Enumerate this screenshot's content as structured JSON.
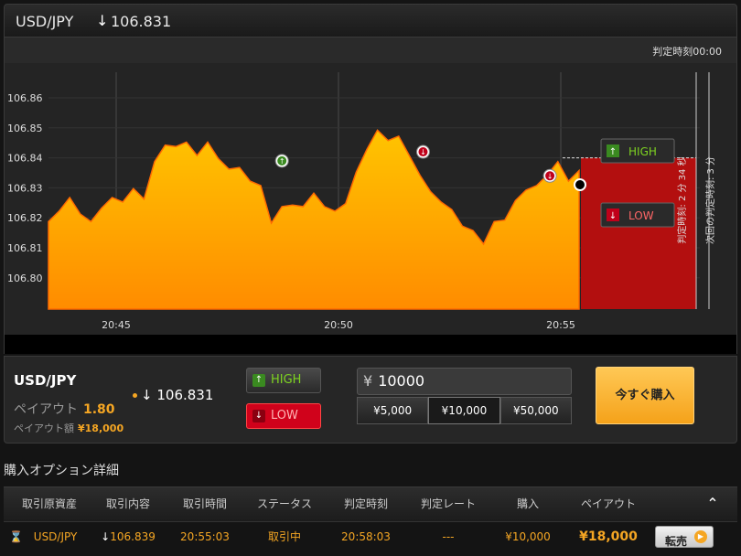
{
  "header": {
    "pair": "USD/JPY",
    "direction_icon": "arrow-down-icon",
    "direction_glyph": "↓",
    "rate": "106.831"
  },
  "subbar": {
    "judge_time": "判定時刻00:00"
  },
  "chart": {
    "yticks": [
      "106.86",
      "106.85",
      "106.84",
      "106.83",
      "106.82",
      "106.81",
      "106.80"
    ],
    "xticks": [
      "20:45",
      "20:50",
      "20:55"
    ],
    "high_label": "HIGH",
    "low_label": "LOW",
    "judge_remaining": "判定時刻: 2 分 34 秒",
    "next_round": "次回の判定時刻: 3 分"
  },
  "chart_data": {
    "type": "area",
    "y_range": [
      106.795,
      106.87
    ],
    "x_ticks": [
      "20:45",
      "20:50",
      "20:55"
    ],
    "series": [
      {
        "values": [
          106.818,
          106.823,
          106.826,
          106.822,
          106.818,
          106.824,
          106.826,
          106.826,
          106.829,
          106.827,
          106.838,
          106.845,
          106.843,
          106.846,
          106.84,
          106.846,
          106.839,
          106.837,
          106.836,
          106.833,
          106.83,
          106.819,
          106.823,
          106.825,
          106.823,
          106.829,
          106.823,
          106.823,
          106.824,
          106.836,
          106.842,
          106.85,
          106.845,
          106.848,
          106.84,
          106.835,
          106.828,
          106.826,
          106.822,
          106.818,
          106.815,
          106.812,
          106.818,
          106.82,
          106.825,
          106.83,
          106.83,
          106.835,
          106.838,
          106.833,
          106.835
        ]
      }
    ],
    "markers": [
      {
        "kind": "high-entry",
        "x": 0.44,
        "y": 106.839
      },
      {
        "kind": "low-entry",
        "x": 0.706,
        "y": 106.842
      },
      {
        "kind": "low-entry",
        "x": 0.945,
        "y": 106.834
      }
    ],
    "entry_rate": 106.84
  },
  "panel": {
    "pair": "USD/JPY",
    "payout_label": "ペイアウト",
    "payout_value": "1.80",
    "payout_amount_label": "ペイアウト額",
    "payout_amount_value": "¥18,000",
    "direction_glyph": "↓",
    "rate": "106.831",
    "high_label": "HIGH",
    "low_label": "LOW",
    "high_glyph": "↑",
    "low_glyph": "↓",
    "amount_currency": "¥",
    "amount_value": "10000",
    "presets": [
      "¥5,000",
      "¥10,000",
      "¥50,000"
    ],
    "selected_preset": "¥10,000",
    "buy_now": "今すぐ購入"
  },
  "options": {
    "title": "購入オプション詳細",
    "headers": [
      "取引原資産",
      "取引内容",
      "取引時間",
      "ステータス",
      "判定時刻",
      "判定レート",
      "購入",
      "ペイアウト"
    ],
    "collapse_glyph": "⌃",
    "row": {
      "icon_glyph": "⌛",
      "asset": "USD/JPY",
      "direction_glyph": "↓",
      "rate": "106.839",
      "time": "20:55:03",
      "status": "取引中",
      "judge_time": "20:58:03",
      "judge_rate": "---",
      "purchase": "¥10,000",
      "payout": "¥18,000",
      "resell_label": "転売",
      "resell_glyph": "▶"
    }
  },
  "colors": {
    "accent": "#f5a623",
    "high": "#7ed321",
    "low": "#d0021b"
  }
}
